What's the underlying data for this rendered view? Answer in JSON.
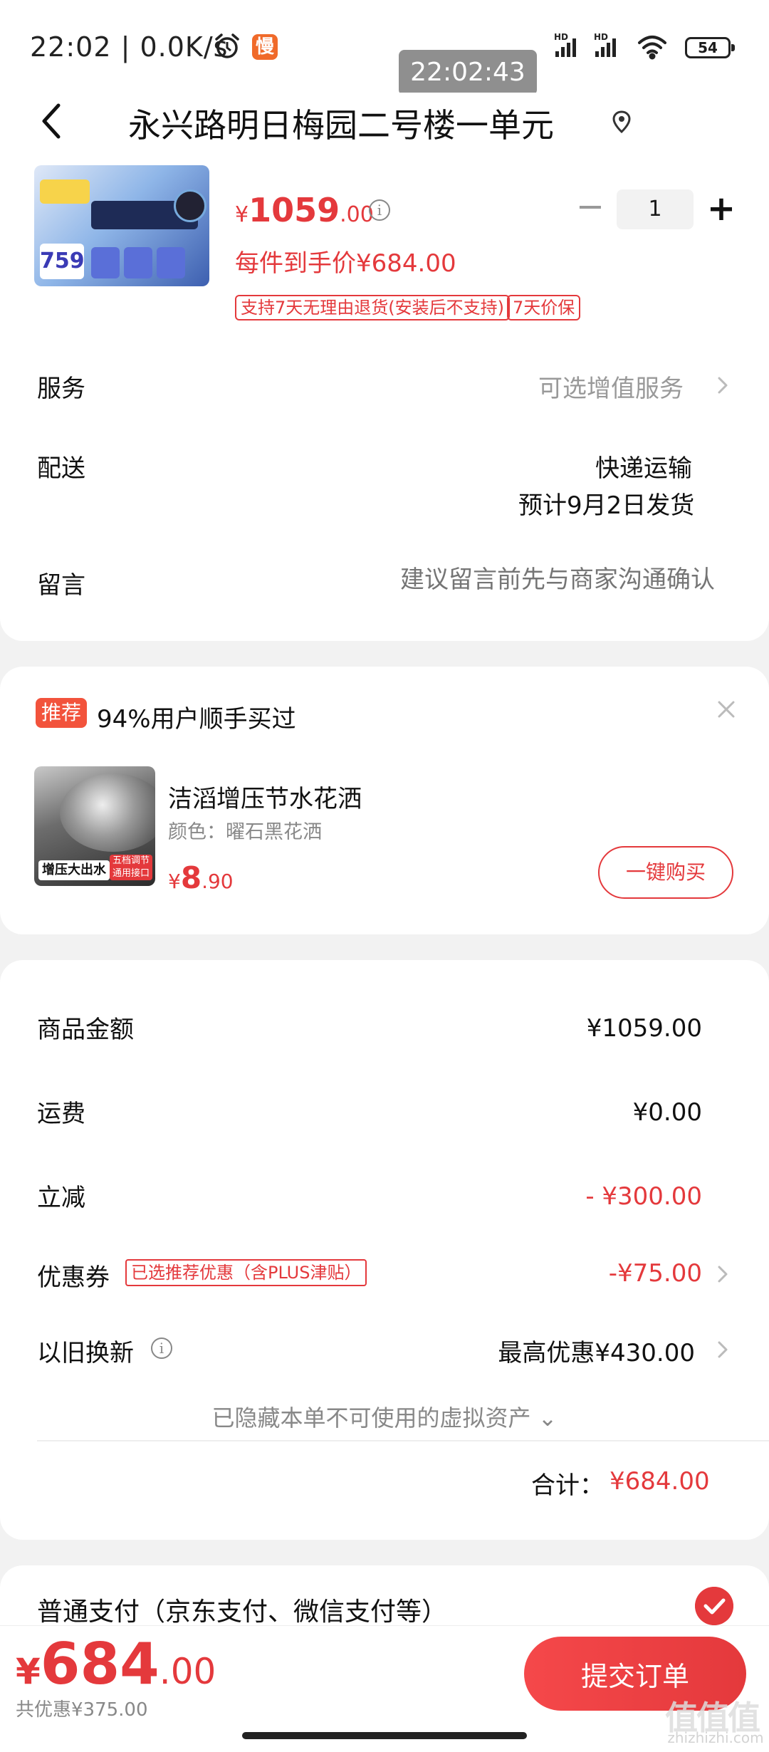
{
  "status_bar": {
    "time": "22:02",
    "network_speed": "0.0K/s",
    "app_icon_text": "慢",
    "signal_icons": [
      "hd-signal-icon",
      "hd-signal-icon",
      "wifi-icon"
    ],
    "battery": "54",
    "time_overlay": "22:02:43"
  },
  "header": {
    "title": "永兴路明日梅园二号楼一单元"
  },
  "product": {
    "price_currency": "¥",
    "price_int": "1059",
    "price_dec": ".00",
    "quantity": "1",
    "unit_price": "每件到手价¥684.00",
    "tags": [
      "支持7天无理由退货(安装后不支持)",
      "7天价保"
    ],
    "image_badge": "759"
  },
  "service": {
    "label": "服务",
    "value": "可选增值服务"
  },
  "shipping": {
    "label": "配送",
    "method": "快递运输",
    "date": "预计9月2日发货"
  },
  "note": {
    "label": "留言",
    "placeholder": "建议留言前先与商家沟通确认"
  },
  "recommend": {
    "badge": "推荐",
    "text": "94%用户顺手买过",
    "item_name": "洁滔增压节水花洒",
    "item_color": "颜色：曜石黑花洒",
    "price_currency": "¥",
    "price_int": "8",
    "price_dec": ".90",
    "buy_label": "一键购买",
    "image_label": "增压大出水",
    "image_label2": "五档调节 通用接口"
  },
  "summary": {
    "goods_label": "商品金额",
    "goods_value": "¥1059.00",
    "freight_label": "运费",
    "freight_value": "¥0.00",
    "discount_label": "立减",
    "discount_value": "- ¥300.00",
    "coupon_label": "优惠券",
    "coupon_tag": "已选推荐优惠（含PLUS津贴）",
    "coupon_value": "-¥75.00",
    "tradein_label": "以旧换新",
    "tradein_value": "最高优惠¥430.00",
    "hidden_assets": "已隐藏本单不可使用的虚拟资产 ⌄",
    "total_label": "合计：",
    "total_value": "¥684.00"
  },
  "payment": {
    "label": "普通支付（京东支付、微信支付等）"
  },
  "bottom": {
    "price_currency": "¥",
    "price_int": "684",
    "price_dec": ".00",
    "saved": "共优惠¥375.00",
    "submit_label": "提交订单",
    "watermark_mark": "值值值",
    "watermark_site": "zhizhizhi.com"
  },
  "colors": {
    "accent": "#e4393c",
    "muted": "#888888",
    "background": "#f2f2f2"
  }
}
